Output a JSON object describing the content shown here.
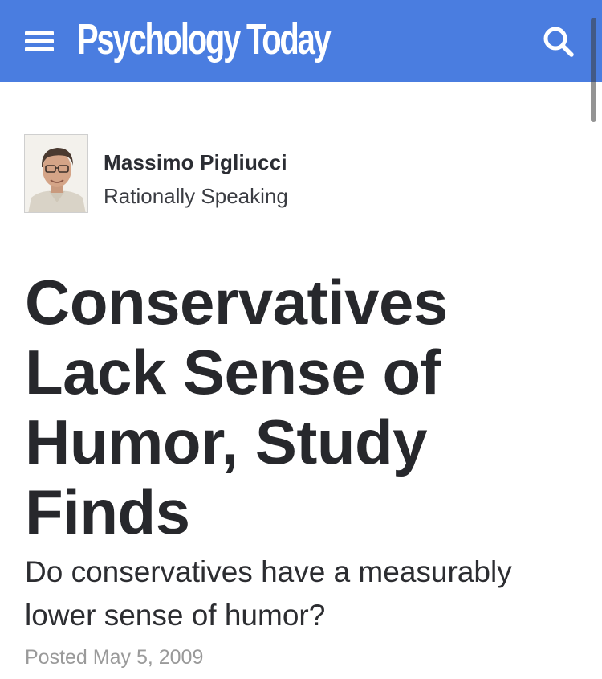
{
  "header": {
    "logo_text": "Psychology Today",
    "bg_color": "#4a7de0",
    "menu_icon": "hamburger-menu-icon",
    "search_icon": "search-icon"
  },
  "author": {
    "name": "Massimo Pigliucci",
    "blog": "Rationally Speaking"
  },
  "article": {
    "title": "Conservatives Lack Sense of Humor, Study Finds",
    "subtitle": "Do conservatives have a measurably lower sense of humor?",
    "posted": "Posted May 5, 2009"
  }
}
